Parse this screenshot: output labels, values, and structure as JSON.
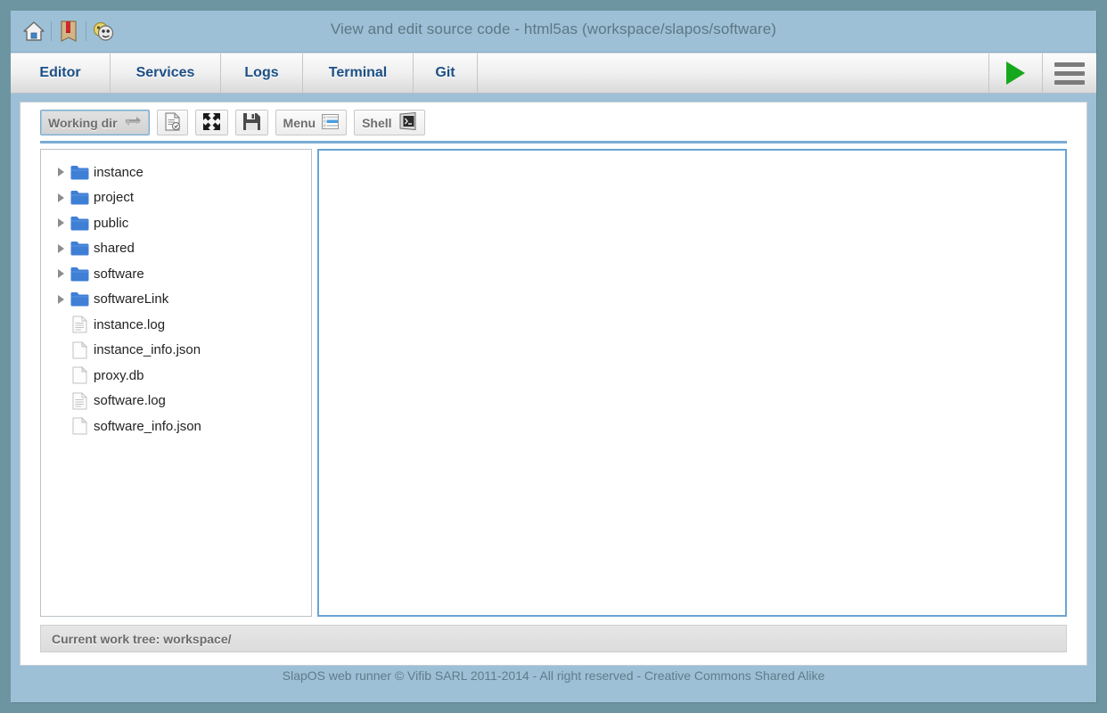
{
  "window": {
    "title": "View and edit source code - html5as (workspace/slapos/software)"
  },
  "titlebar_icons": [
    {
      "name": "home-icon",
      "glyph": "home"
    },
    {
      "name": "book-icon",
      "glyph": "book"
    },
    {
      "name": "mask-icon",
      "glyph": "mask"
    }
  ],
  "nav": {
    "tabs": [
      {
        "label": "Editor"
      },
      {
        "label": "Services"
      },
      {
        "label": "Logs"
      },
      {
        "label": "Terminal"
      },
      {
        "label": "Git"
      }
    ],
    "run_button": {
      "name": "run-icon",
      "label": ""
    },
    "menu_button": {
      "name": "hamburger-menu-icon",
      "label": ""
    }
  },
  "toolbar": {
    "working_dir_label": "Working dir",
    "working_dir_icon": "swap-arrows-icon",
    "new_file_icon": "document-add-icon",
    "fullscreen_icon": "fullscreen-icon",
    "save_icon": "save-floppy-icon",
    "menu_label": "Menu",
    "menu_icon": "list-menu-icon",
    "shell_label": "Shell",
    "shell_icon": "terminal-icon"
  },
  "tree": {
    "items": [
      {
        "label": "instance",
        "type": "folder",
        "expandable": true
      },
      {
        "label": "project",
        "type": "folder",
        "expandable": true
      },
      {
        "label": "public",
        "type": "folder",
        "expandable": true
      },
      {
        "label": "shared",
        "type": "folder",
        "expandable": true
      },
      {
        "label": "software",
        "type": "folder",
        "expandable": true
      },
      {
        "label": "softwareLink",
        "type": "folder",
        "expandable": true
      },
      {
        "label": "instance.log",
        "type": "log",
        "expandable": false
      },
      {
        "label": "instance_info.json",
        "type": "file",
        "expandable": false
      },
      {
        "label": "proxy.db",
        "type": "file",
        "expandable": false
      },
      {
        "label": "software.log",
        "type": "log",
        "expandable": false
      },
      {
        "label": "software_info.json",
        "type": "file",
        "expandable": false
      }
    ]
  },
  "status": {
    "text": "Current work tree: workspace/"
  },
  "footer": {
    "text": "SlapOS web runner © Vifib SARL 2011-2014 - All right reserved - Creative Commons Shared Alike"
  },
  "colors": {
    "desktop": "#6d95a1",
    "window": "#9dc0d6",
    "accent_blue": "#7aabd4",
    "tab_text": "#1b4f86",
    "run_green": "#16a81c"
  }
}
